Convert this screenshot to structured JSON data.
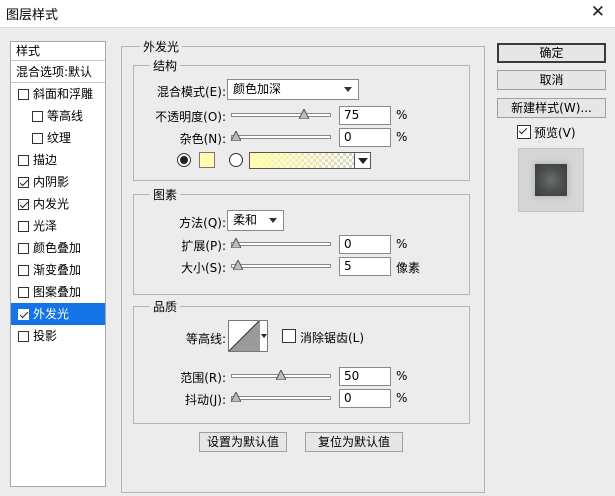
{
  "window": {
    "title": "图层样式",
    "close_glyph": "✕"
  },
  "style_list": {
    "header": "样式",
    "blend_options": "混合选项:默认",
    "items": [
      {
        "label": "斜面和浮雕",
        "checked": false,
        "indent": false,
        "selected": false
      },
      {
        "label": "等高线",
        "checked": false,
        "indent": true,
        "selected": false
      },
      {
        "label": "纹理",
        "checked": false,
        "indent": true,
        "selected": false
      },
      {
        "label": "描边",
        "checked": false,
        "indent": false,
        "selected": false
      },
      {
        "label": "内阴影",
        "checked": true,
        "indent": false,
        "selected": false
      },
      {
        "label": "内发光",
        "checked": true,
        "indent": false,
        "selected": false
      },
      {
        "label": "光泽",
        "checked": false,
        "indent": false,
        "selected": false
      },
      {
        "label": "颜色叠加",
        "checked": false,
        "indent": false,
        "selected": false
      },
      {
        "label": "渐变叠加",
        "checked": false,
        "indent": false,
        "selected": false
      },
      {
        "label": "图案叠加",
        "checked": false,
        "indent": false,
        "selected": false
      },
      {
        "label": "外发光",
        "checked": true,
        "indent": false,
        "selected": true
      },
      {
        "label": "投影",
        "checked": false,
        "indent": false,
        "selected": false
      }
    ]
  },
  "panel": {
    "title": "外发光",
    "structure": {
      "title": "结构",
      "blend_mode_label": "混合模式(E):",
      "blend_mode_value": "颜色加深",
      "opacity_label": "不透明度(O):",
      "opacity_value": "75",
      "opacity_fraction": 0.75,
      "noise_label": "杂色(N):",
      "noise_value": "0",
      "noise_fraction": 0,
      "percent": "%",
      "color_mode": "solid",
      "glow_color": "#fffdae"
    },
    "elements": {
      "title": "图素",
      "technique_label": "方法(Q):",
      "technique_value": "柔和",
      "spread_label": "扩展(P):",
      "spread_value": "0",
      "spread_fraction": 0,
      "size_label": "大小(S):",
      "size_value": "5",
      "size_fraction": 0.02,
      "percent": "%",
      "px_unit": "像素"
    },
    "quality": {
      "title": "品质",
      "contour_label": "等高线:",
      "antialias_label": "消除锯齿(L)",
      "antialias_checked": false,
      "range_label": "范围(R):",
      "range_value": "50",
      "range_fraction": 0.5,
      "jitter_label": "抖动(J):",
      "jitter_value": "0",
      "jitter_fraction": 0,
      "percent": "%"
    },
    "make_default": "设置为默认值",
    "reset_default": "复位为默认值"
  },
  "buttons": {
    "ok": "确定",
    "cancel": "取消",
    "new_style": "新建样式(W)...",
    "preview_label": "预览(V)",
    "preview_checked": true
  }
}
